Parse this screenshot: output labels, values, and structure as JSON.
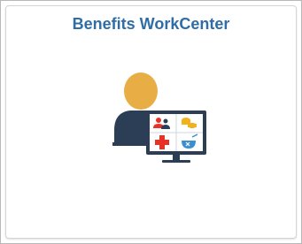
{
  "tile": {
    "title": "Benefits WorkCenter",
    "image": {
      "icon": "benefits-workcenter-icon",
      "colors": {
        "person_head": "#e8ae45",
        "person_body": "#2c3e55",
        "monitor_frame": "#2c3e55",
        "monitor_screen": "#ffffff",
        "cross": "#e63326",
        "coins": "#f2b21d",
        "bowl": "#3a8fd0"
      }
    }
  }
}
